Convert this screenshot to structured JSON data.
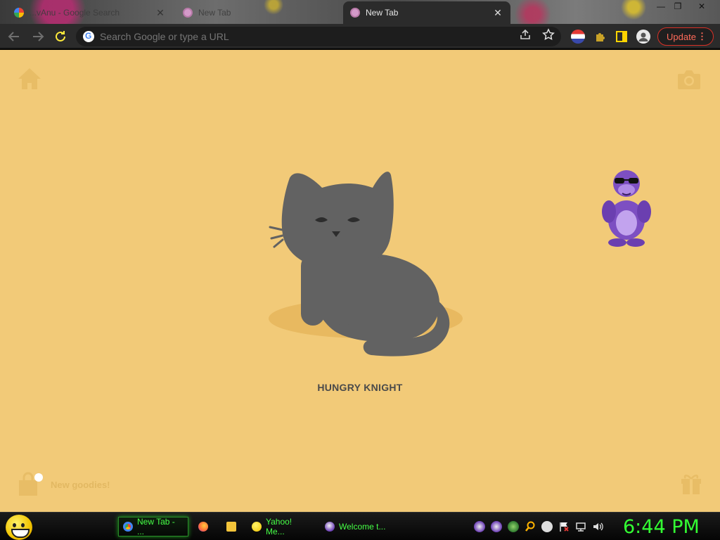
{
  "browser": {
    "tabs": [
      {
        "title": "...vAnu - Google Search",
        "state": "inactive"
      },
      {
        "title": "New Tab",
        "state": "inactive"
      },
      {
        "title": "New Tab",
        "state": "active"
      }
    ],
    "tab_close_glyph": "✕",
    "window_controls": {
      "minimize": "—",
      "restore": "❐",
      "close": "✕"
    },
    "omnibox": {
      "placeholder": "Search Google or type a URL",
      "value": ""
    },
    "update_label": "Update",
    "menu_glyph": "⋮"
  },
  "new_tab_page": {
    "background_color": "#f2ca78",
    "cat_name": "HUNGRY KNIGHT",
    "goodies_label": "New goodies!",
    "icons": [
      "home-icon",
      "camera-icon",
      "gift-icon",
      "shopping-bag-icon"
    ]
  },
  "desktop_buddy": {
    "icon": "purple-gorilla-sunglasses"
  },
  "taskbar": {
    "tasks": [
      {
        "label": "New Tab - ...",
        "active": true,
        "icon": "chrome-icon"
      },
      {
        "label": "",
        "active": false,
        "icon": "firefox-icon"
      },
      {
        "label": "",
        "active": false,
        "icon": "folder-icon"
      },
      {
        "label": "Yahoo! Me...",
        "active": false,
        "icon": "yahoo-messenger-icon"
      },
      {
        "label": "Welcome t...",
        "active": false,
        "icon": "bonzi-icon"
      }
    ],
    "clock": "6:44 PM"
  }
}
